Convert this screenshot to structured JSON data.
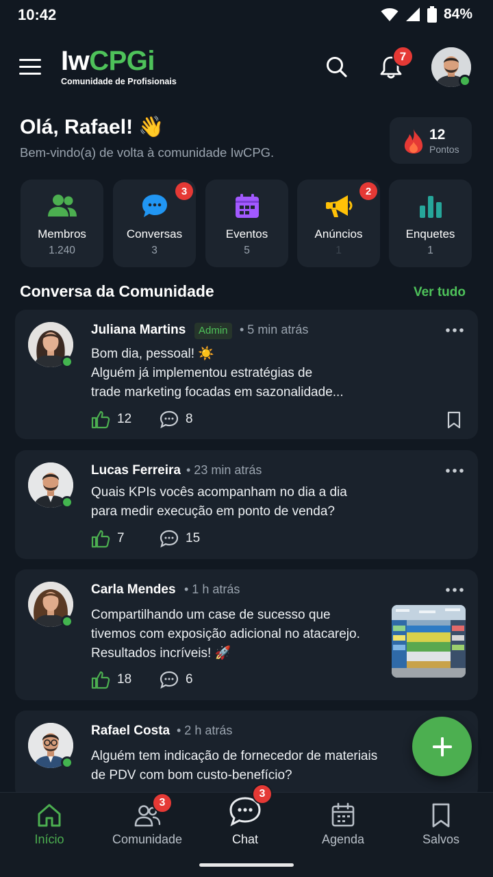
{
  "status_bar": {
    "time": "10:42",
    "battery": "84%"
  },
  "header": {
    "logo_main_white": "Iw",
    "logo_main_green": "CPGi",
    "logo_subtitle": "Comunidade de Profisionais",
    "notification_count": "7"
  },
  "greeting": {
    "title": "Olá, Rafael! 👋",
    "subtitle": "Bem-vindo(a) de volta à comunidade IwCPG.",
    "points_value": "12",
    "points_label": "Pontos"
  },
  "quick_cards": [
    {
      "label": "Membros",
      "count": "1.240",
      "badge": ""
    },
    {
      "label": "Conversas",
      "count": "3",
      "badge": "3"
    },
    {
      "label": "Eventos",
      "count": "5",
      "badge": ""
    },
    {
      "label": "Anúncios",
      "count": "1",
      "badge": "2"
    },
    {
      "label": "Enquetes",
      "count": "1",
      "badge": ""
    }
  ],
  "section": {
    "title": "Conversa da Comunidade",
    "see_all": "Ver tudo"
  },
  "posts": [
    {
      "author": "Juliana Martins",
      "role_badge": "Admin",
      "time": "• 5 min atrás",
      "line1": "Bom dia, pessoal! ☀️",
      "line2": "Alguém já implementou estratégias de",
      "line3": "trade marketing focadas em sazonalidade...",
      "likes": "12",
      "comments": "8"
    },
    {
      "author": "Lucas Ferreira",
      "time": "• 23 min atrás",
      "line1": "Quais KPIs vocês acompanham no dia a dia",
      "line2": "para medir execução em ponto de venda?",
      "likes": "7",
      "comments": "15"
    },
    {
      "author": "Carla Mendes",
      "time": "• 1 h atrás",
      "line1": "Compartilhando um case de sucesso que",
      "line2": "tivemos com exposição adicional no atacarejo.",
      "line3": "Resultados incríveis! 🚀",
      "likes": "18",
      "comments": "6"
    },
    {
      "author": "Rafael Costa",
      "time": "• 2 h atrás",
      "line1": "Alguém tem indicação de fornecedor de materiais",
      "line2": "de PDV com bom custo-benefício?"
    }
  ],
  "bottom_nav": [
    {
      "label": "Início",
      "badge": ""
    },
    {
      "label": "Comunidade",
      "badge": "3"
    },
    {
      "label": "Chat",
      "badge": "3"
    },
    {
      "label": "Agenda",
      "badge": ""
    },
    {
      "label": "Salvos",
      "badge": ""
    }
  ],
  "colors": {
    "accent": "#4ec25a",
    "badge": "#e53935",
    "background": "#111821",
    "card": "#1a222c"
  },
  "icons": {
    "header": [
      "menu-icon",
      "search-icon",
      "bell-icon"
    ],
    "quick_cards": [
      "people-icon",
      "chat-bubble-icon",
      "calendar-icon",
      "megaphone-icon",
      "bar-chart-icon"
    ],
    "post": [
      "thumbs-up-icon",
      "comment-icon",
      "bookmark-icon",
      "more-icon"
    ],
    "nav": [
      "home-icon",
      "community-icon",
      "chat-icon",
      "agenda-icon",
      "bookmark-icon"
    ]
  }
}
